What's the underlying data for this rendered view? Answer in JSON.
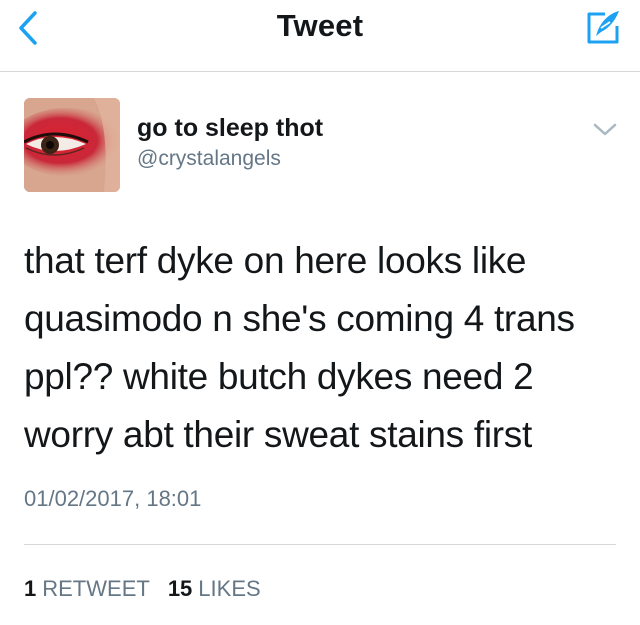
{
  "nav": {
    "title": "Tweet",
    "back_icon": "chevron-left-icon",
    "compose_icon": "compose-tweet-icon",
    "accent_color": "#1da1f2"
  },
  "tweet": {
    "user_name": "go to sleep thot",
    "user_handle": "@crystalangels",
    "text": "that terf dyke on here looks like\nquasimodo n she's coming 4 trans\nppl?? white butch dykes need 2\nworry abt their sweat stains first",
    "timestamp": "01/02/2017, 18:01",
    "menu_icon": "chevron-down-icon"
  },
  "stats": {
    "retweets_count": "1",
    "retweets_label": "RETWEET",
    "likes_count": "15",
    "likes_label": "LIKES"
  }
}
